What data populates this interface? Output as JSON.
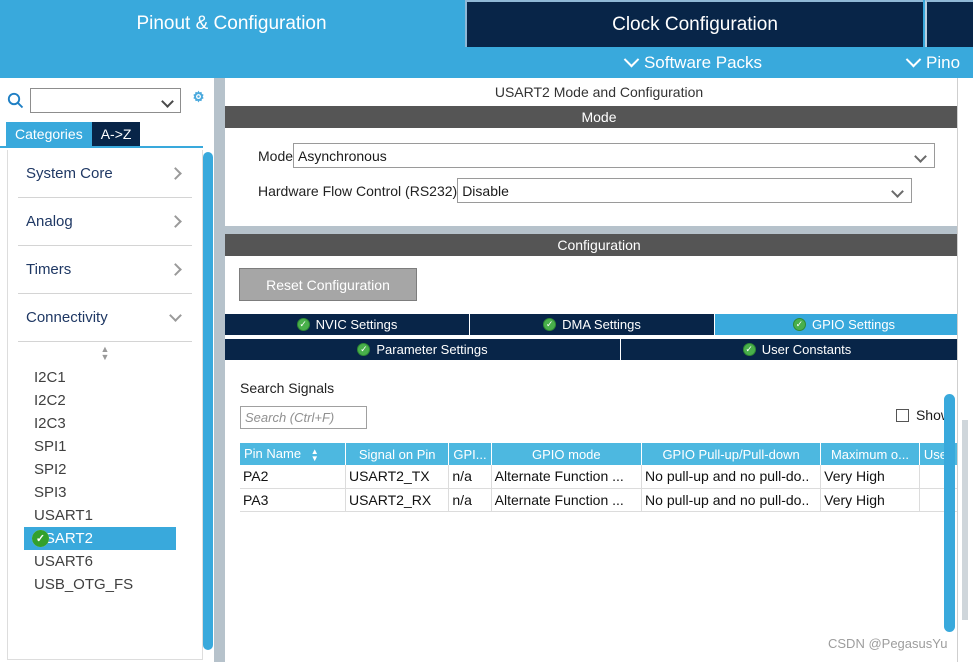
{
  "nav": {
    "tabs": [
      {
        "label": "Pinout & Configuration",
        "active": false
      },
      {
        "label": "Clock Configuration",
        "active": true
      },
      {
        "label": "",
        "active": true
      }
    ],
    "subnav": {
      "software_packs": "Software Packs",
      "pinout_partial": "Pino"
    }
  },
  "sidebar": {
    "search": {
      "value": "",
      "placeholder": ""
    },
    "gear_icon": "gear-icon",
    "search_icon": "search-icon",
    "tabs": [
      {
        "label": "Categories",
        "selected": true
      },
      {
        "label": "A->Z",
        "selected": false
      }
    ],
    "categories": [
      {
        "label": "System Core",
        "expanded": false
      },
      {
        "label": "Analog",
        "expanded": false
      },
      {
        "label": "Timers",
        "expanded": false
      },
      {
        "label": "Connectivity",
        "expanded": true
      }
    ],
    "peripherals": [
      {
        "label": "I2C1",
        "selected": false,
        "configured": false
      },
      {
        "label": "I2C2",
        "selected": false,
        "configured": false
      },
      {
        "label": "I2C3",
        "selected": false,
        "configured": false
      },
      {
        "label": "SPI1",
        "selected": false,
        "configured": false
      },
      {
        "label": "SPI2",
        "selected": false,
        "configured": false
      },
      {
        "label": "SPI3",
        "selected": false,
        "configured": false
      },
      {
        "label": "USART1",
        "selected": false,
        "configured": false
      },
      {
        "label": "USART2",
        "selected": true,
        "configured": true
      },
      {
        "label": "USART6",
        "selected": false,
        "configured": false
      },
      {
        "label": "USB_OTG_FS",
        "selected": false,
        "configured": false
      }
    ]
  },
  "main": {
    "panel_title": "USART2 Mode and Configuration",
    "mode_band": "Mode",
    "mode_form": {
      "mode_label": "Mode",
      "mode_value": "Asynchronous",
      "hfc_label": "Hardware Flow Control (RS232)",
      "hfc_value": "Disable"
    },
    "configuration_band": "Configuration",
    "reset_button": "Reset Configuration",
    "config_tabs_row1": [
      {
        "label": "NVIC Settings",
        "active": false
      },
      {
        "label": "DMA Settings",
        "active": false
      },
      {
        "label": "GPIO Settings",
        "active": true
      }
    ],
    "config_tabs_row2": [
      {
        "label": "Parameter Settings",
        "active": false
      },
      {
        "label": "User Constants",
        "active": false
      }
    ],
    "signals": {
      "label": "Search Signals",
      "search_value": "",
      "search_placeholder": "Search (Ctrl+F)",
      "show_label": "Show",
      "show_checked": false
    },
    "table": {
      "headers": [
        "Pin Name",
        "Signal on Pin",
        "GPI...",
        "GPIO mode",
        "GPIO Pull-up/Pull-down",
        "Maximum o...",
        "User"
      ],
      "sort_column": "Pin Name",
      "rows": [
        {
          "pin_name": "PA2",
          "signal_on_pin": "USART2_TX",
          "gpio_output": "n/a",
          "gpio_mode": "Alternate Function ...",
          "gpio_pull": "No pull-up and no pull-do..",
          "max_output": "Very High",
          "user_label": ""
        },
        {
          "pin_name": "PA3",
          "signal_on_pin": "USART2_RX",
          "gpio_output": "n/a",
          "gpio_mode": "Alternate Function ...",
          "gpio_pull": "No pull-up and no pull-do..",
          "max_output": "Very High",
          "user_label": ""
        }
      ]
    }
  },
  "watermark": "CSDN @PegasusYu",
  "colors": {
    "brand_blue": "#39a9dc",
    "dark_navy": "#082548",
    "band_gray": "#555555",
    "header_blue": "#4db8e0",
    "check_green": "#33a02c"
  }
}
